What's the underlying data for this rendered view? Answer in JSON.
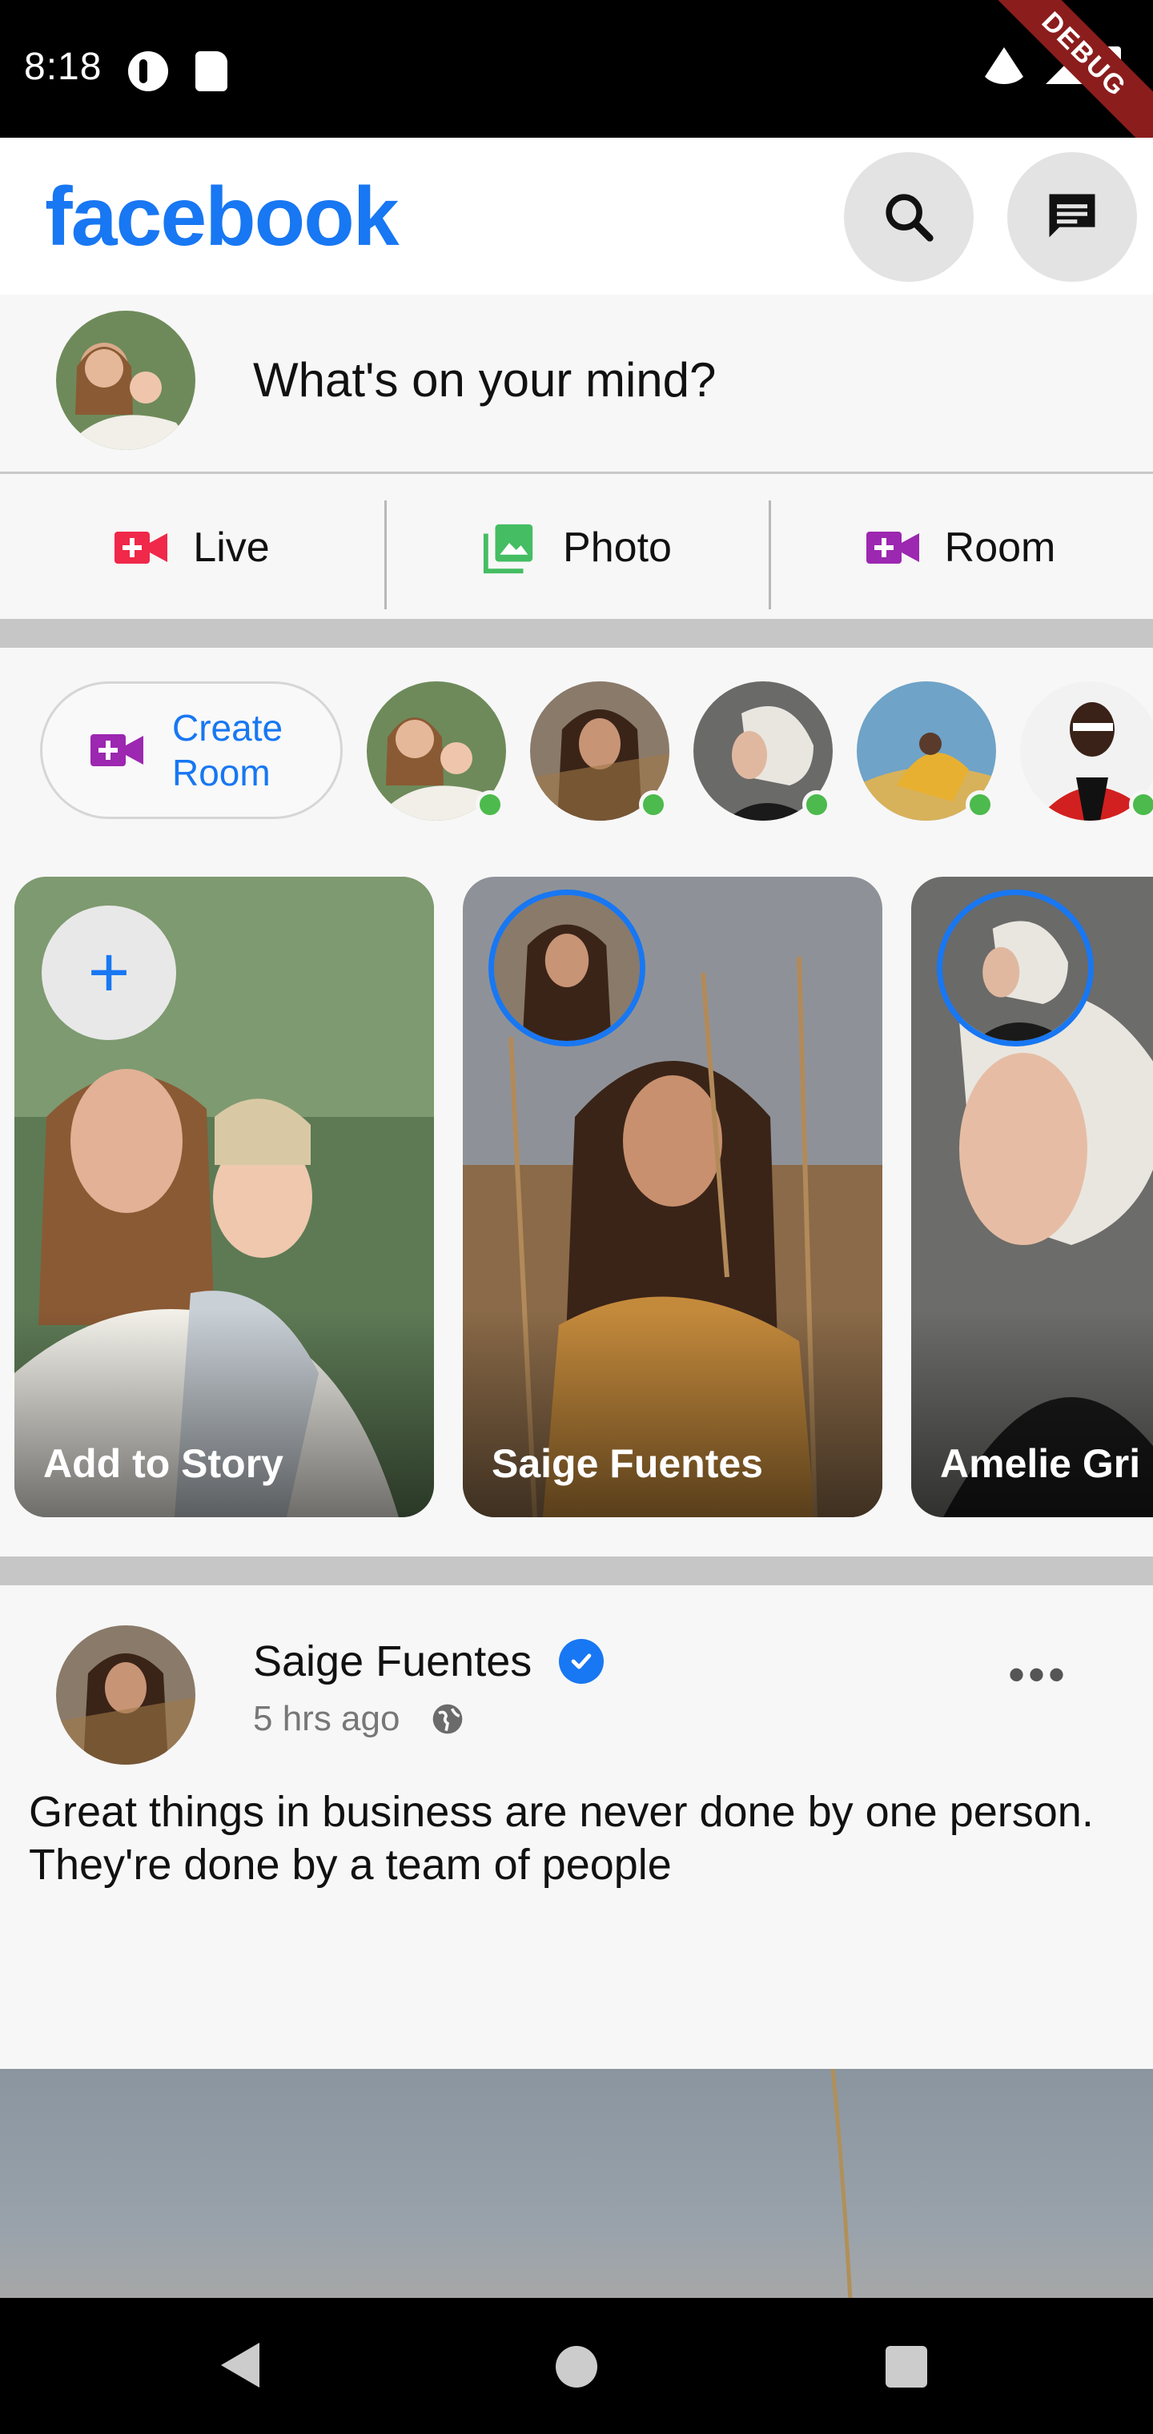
{
  "status_bar": {
    "time": "8:18",
    "debug_label": "DEBUG"
  },
  "app": {
    "logo": "facebook",
    "brand_color": "#1877f2"
  },
  "composer": {
    "placeholder": "What's on your mind?"
  },
  "actions": [
    {
      "label": "Live",
      "icon": "live-video-icon",
      "color": "#f02849"
    },
    {
      "label": "Photo",
      "icon": "photo-icon",
      "color": "#45bd62"
    },
    {
      "label": "Room",
      "icon": "video-room-icon",
      "color": "#9c27b0"
    }
  ],
  "rooms": {
    "create_label": "Create\nRoom"
  },
  "stories": [
    {
      "label": "Add to Story"
    },
    {
      "label": "Saige Fuentes"
    },
    {
      "label": "Amelie Gri"
    }
  ],
  "post": {
    "author": "Saige Fuentes",
    "time": "5 hrs ago",
    "privacy_icon": "globe-icon",
    "text": "Great things in business are never done by one person. They're done by a team of people"
  }
}
